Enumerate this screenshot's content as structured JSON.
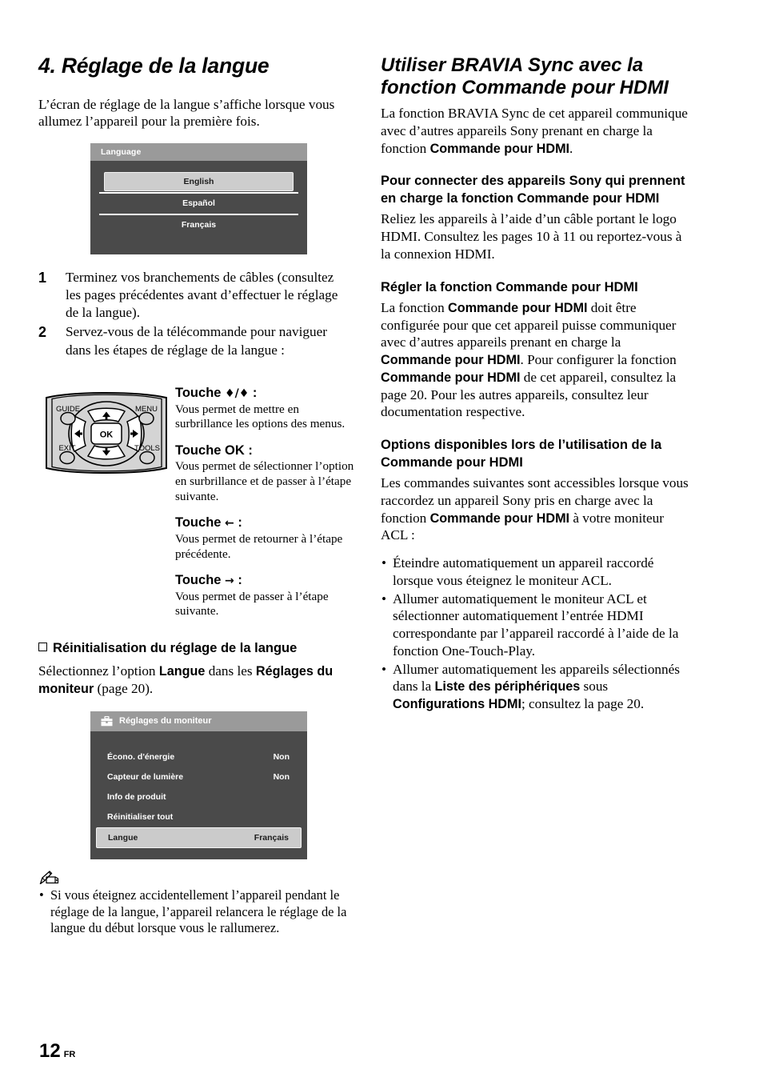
{
  "page": {
    "number": "12",
    "locale": "FR"
  },
  "left": {
    "chapter_title": "4. Réglage de la langue",
    "intro": "L’écran de réglage de la langue s’affiche lorsque vous allumez l’appareil pour la première fois.",
    "language_osd": {
      "title": "Language",
      "options": [
        "English",
        "Español",
        "Français"
      ],
      "selected": "English",
      "bg_color": "#4a4a4a",
      "titlebar_color": "#9a9a9a",
      "highlight_color": "#cdcdcd"
    },
    "steps": [
      {
        "num": "1",
        "text": "Terminez vos branchements de câbles (consultez les pages précédentes avant d’effectuer le réglage de la langue)."
      },
      {
        "num": "2",
        "text": "Servez-vous de la télécommande pour naviguer dans les étapes de réglage de la langue :"
      }
    ],
    "remote": {
      "buttons": [
        "GUIDE",
        "MENU",
        "EXIT",
        "TOOLS"
      ],
      "center_button": "OK",
      "dpad": [
        "up",
        "down",
        "left",
        "right"
      ]
    },
    "keys": [
      {
        "title_prefix": "Touche",
        "title_symbol": "♦/♦",
        "title_suffix": ":",
        "desc": "Vous permet de mettre en surbrillance les options des menus."
      },
      {
        "title_prefix": "Touche OK",
        "title_symbol": "",
        "title_suffix": ":",
        "desc": "Vous permet de sélectionner l’option en surbrillance et de passer à l’étape suivante."
      },
      {
        "title_prefix": "Touche",
        "title_symbol": "←",
        "title_suffix": ":",
        "desc": "Vous permet de retourner à l’étape précédente."
      },
      {
        "title_prefix": "Touche",
        "title_symbol": "→",
        "title_suffix": ":",
        "desc": "Vous permet de passer à l’étape suivante."
      }
    ],
    "reset": {
      "heading": "Réinitialisation du réglage de la langue",
      "text_1": "Sélectionnez l’option ",
      "bold_1": "Langue",
      "text_2": " dans les ",
      "bold_2": "Réglages du moniteur",
      "text_3": " (page 20)."
    },
    "settings_osd": {
      "title": "Réglages du moniteur",
      "icon": "toolbox-icon",
      "items": [
        {
          "label": "Écono. d'énergie",
          "value": "Non",
          "highlight": false
        },
        {
          "label": "Capteur de lumière",
          "value": "Non",
          "highlight": false
        },
        {
          "label": "Info de produit",
          "value": "",
          "highlight": false
        },
        {
          "label": "Réinitialiser tout",
          "value": "",
          "highlight": false
        },
        {
          "label": "Langue",
          "value": "Français",
          "highlight": true
        }
      ]
    },
    "note": {
      "icon": "pen-note-icon",
      "bullets": [
        "Si vous éteignez accidentellement l’appareil pendant le réglage de la langue, l’appareil relancera le réglage de la langue du début lorsque vous le rallumerez."
      ]
    }
  },
  "right": {
    "section_title": "Utiliser BRAVIA Sync avec la fonction Commande pour HDMI",
    "intro_1": "La fonction BRAVIA Sync de cet appareil communique avec d’autres appareils Sony prenant en charge la fonction ",
    "intro_bold": "Commande pour HDMI",
    "intro_2": ".",
    "connect": {
      "heading": "Pour connecter des appareils Sony qui prennent en charge la fonction Commande pour HDMI",
      "text": "Reliez les appareils à l’aide d’un câble portant le logo HDMI. Consultez les pages 10 à 11 ou reportez-vous à la connexion HDMI."
    },
    "configure": {
      "heading": "Régler la fonction Commande pour HDMI",
      "p1_a": "La fonction ",
      "p1_b1": "Commande pour HDMI",
      "p1_c": " doit être configurée pour que cet appareil puisse communiquer avec d’autres appareils prenant en charge la ",
      "p1_b2": "Commande pour HDMI",
      "p1_d": ". Pour configurer la fonction ",
      "p1_b3": "Commande pour HDMI",
      "p1_e": " de cet appareil, consultez la page 20. Pour les autres appareils, consultez leur documentation respective."
    },
    "options": {
      "heading": "Options disponibles lors de l’utilisation de la Commande pour HDMI",
      "lead_a": "Les commandes suivantes sont accessibles lorsque vous raccordez un appareil Sony pris en charge avec la fonction ",
      "lead_b": "Commande pour HDMI",
      "lead_c": " à votre moniteur ACL :",
      "bullets": [
        {
          "parts": [
            {
              "t": "Éteindre automatiquement un appareil raccordé lorsque vous éteignez le moniteur ACL.",
              "bold": false
            }
          ]
        },
        {
          "parts": [
            {
              "t": "Allumer automatiquement le moniteur ACL et sélectionner automatiquement l’entrée HDMI correspondante par l’appareil raccordé à l’aide de la fonction One-Touch-Play.",
              "bold": false
            }
          ]
        },
        {
          "parts": [
            {
              "t": "Allumer automatiquement les appareils sélectionnés dans la ",
              "bold": false
            },
            {
              "t": "Liste des périphériques",
              "bold": true
            },
            {
              "t": " sous ",
              "bold": false
            },
            {
              "t": "Configurations HDMI",
              "bold": true
            },
            {
              "t": "; consultez la page 20.",
              "bold": false
            }
          ]
        }
      ]
    }
  }
}
